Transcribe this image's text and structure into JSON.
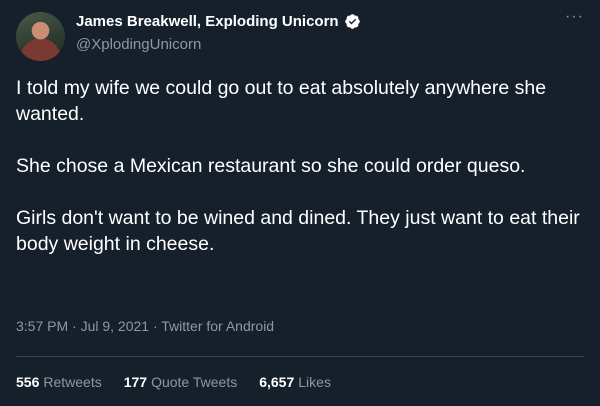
{
  "author": {
    "name": "James Breakwell, Exploding Unicorn",
    "handle": "@XplodingUnicorn"
  },
  "menu": {
    "label": "···"
  },
  "tweet": {
    "paragraphs": [
      "I told my wife we could go out to eat absolutely anywhere she wanted.",
      "She chose a Mexican restaurant so she could order queso.",
      "Girls don't want to be wined and dined. They just want to eat their body weight in cheese."
    ],
    "timestamp": "3:57 PM · Jul 9, 2021 · Twitter for Android"
  },
  "stats": {
    "retweets": {
      "count": "556",
      "label": "Retweets"
    },
    "quote_tweets": {
      "count": "177",
      "label": "Quote Tweets"
    },
    "likes": {
      "count": "6,657",
      "label": "Likes"
    }
  },
  "colors": {
    "background": "#15202b",
    "text": "#ffffff",
    "secondary": "#8b98a5",
    "verified": "#1d9bf0",
    "divider": "#38444d"
  }
}
